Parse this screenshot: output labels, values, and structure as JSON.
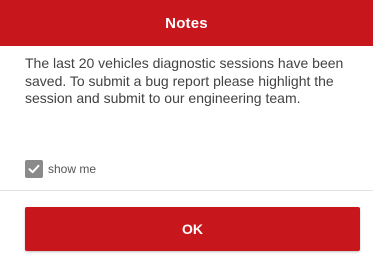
{
  "dialog": {
    "title": "Notes",
    "message": "The last 20 vehicles diagnostic sessions have been saved. To submit a bug report please highlight the session and submit to our engineering team.",
    "checkbox": {
      "label": "show me",
      "checked": true
    },
    "ok_label": "OK"
  },
  "colors": {
    "accent": "#c8161d",
    "text": "#424242",
    "checkbox": "#8a8a8a"
  }
}
